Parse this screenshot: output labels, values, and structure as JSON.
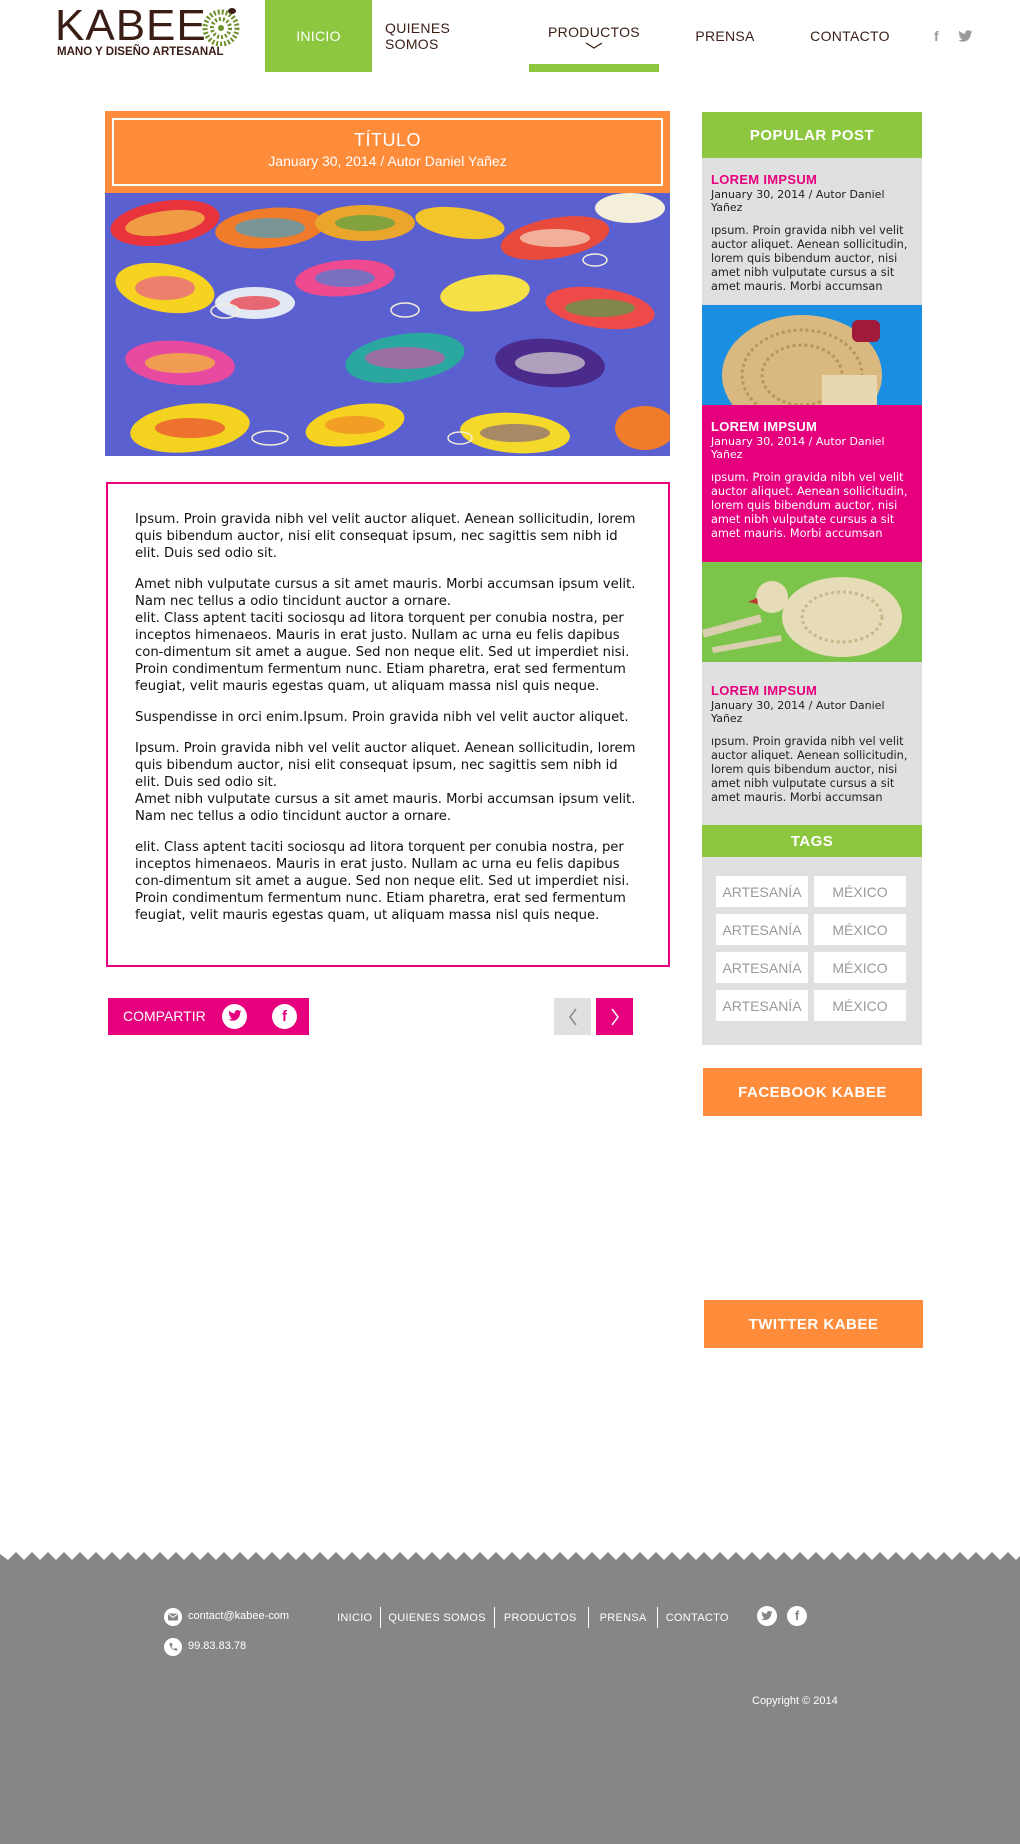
{
  "brand": {
    "name": "KABEE",
    "tagline": "MANO Y DISEÑO ARTESANAL"
  },
  "nav": {
    "items": [
      {
        "label": "INICIO",
        "state": "active"
      },
      {
        "label": "QUIENES SOMOS",
        "state": "normal"
      },
      {
        "label": "PRODUCTOS",
        "state": "hover"
      },
      {
        "label": "PRENSA",
        "state": "normal"
      },
      {
        "label": "CONTACTO",
        "state": "normal"
      }
    ],
    "social": {
      "facebook": "f",
      "twitter": "twitter-bird"
    }
  },
  "article": {
    "title": "TÍTULO",
    "meta": "January 30, 2014  / Autor Daniel Yañez",
    "image_icon": "woven-fish-photo",
    "paragraphs": [
      "Ipsum. Proin gravida nibh vel velit auctor aliquet. Aenean sollicitudin, lorem quis bibendum auctor, nisi elit consequat ipsum, nec sagittis sem nibh id elit. Duis sed odio sit.",
      "Amet nibh vulputate cursus a sit amet mauris. Morbi accumsan ipsum velit. Nam nec tellus a odio tincidunt auctor a ornare.\nelit. Class aptent taciti sociosqu ad litora torquent per conubia nostra, per inceptos himenaeos. Mauris in erat justo. Nullam ac urna eu felis dapibus con-dimentum sit amet a augue. Sed non neque elit. Sed ut imperdiet nisi.\nProin condimentum fermentum nunc. Etiam pharetra, erat sed fermentum feugiat, velit mauris egestas quam, ut aliquam massa nisl quis neque.",
      "Suspendisse in orci enim.Ipsum. Proin gravida nibh vel velit auctor aliquet.",
      "Ipsum. Proin gravida nibh vel velit auctor aliquet. Aenean sollicitudin, lorem quis bibendum auctor, nisi elit consequat ipsum, nec sagittis sem nibh id elit. Duis sed odio sit.\nAmet nibh vulputate cursus a sit amet mauris. Morbi accumsan ipsum velit. Nam nec tellus a odio tincidunt auctor a ornare.",
      "elit. Class aptent taciti sociosqu ad litora torquent per conubia nostra, per inceptos himenaeos. Mauris in erat justo. Nullam ac urna eu felis dapibus con-dimentum sit amet a augue. Sed non neque elit. Sed ut imperdiet nisi.\nProin condimentum fermentum nunc. Etiam pharetra, erat sed fermentum feugiat, velit mauris egestas quam, ut aliquam massa nisl quis neque."
    ],
    "share_label": "COMPARTIR"
  },
  "sidebar": {
    "popular_title": "POPULAR POST",
    "posts": [
      {
        "title": "LOREM IMPSUM",
        "meta": "January 30, 2014  / Autor Daniel Yañez",
        "text": "ıpsum. Proin gravida nibh vel velit auctor aliquet. Aenean sollicitudin, lorem quis bibendum auctor, nisi  amet nibh vulputate cursus a sit amet mauris. Morbi accumsan"
      },
      {
        "title": "LOREM IMPSUM",
        "meta": "January 30, 2014  / Autor Daniel Yañez",
        "text": "ıpsum. Proin gravida nibh vel velit auctor aliquet. Aenean sollicitudin, lorem quis bibendum auctor, nisi  amet nibh vulputate cursus a sit amet mauris. Morbi accumsan"
      },
      {
        "title": "LOREM IMPSUM",
        "meta": "January 30, 2014  / Autor Daniel Yañez",
        "text": "ıpsum. Proin gravida nibh vel velit auctor aliquet. Aenean sollicitudin, lorem quis bibendum auctor, nisi  amet nibh vulputate cursus a sit amet mauris. Morbi accumsan"
      }
    ],
    "tags_title": "TAGS",
    "tags": [
      "ARTESANÍA",
      "MÉXICO",
      "ARTESANÍA",
      "MÉXICO",
      "ARTESANÍA",
      "MÉXICO",
      "ARTESANÍA",
      "MÉXICO"
    ],
    "facebook_label": "FACEBOOK KABEE",
    "twitter_label": "TWITTER KABEE"
  },
  "footer": {
    "email": "contact@kabee-com",
    "phone": "99.83.83.78",
    "links": [
      "INICIO",
      "QUIENES SOMOS",
      "PRODUCTOS",
      "PRENSA",
      "CONTACTO"
    ],
    "copyright": "Copyright © 2014"
  },
  "colors": {
    "green": "#8dc63f",
    "orange": "#ff8c3a",
    "pink": "#e6007e",
    "grey": "#e0e0e0",
    "footer": "#868688",
    "brown": "#3a1e16"
  }
}
